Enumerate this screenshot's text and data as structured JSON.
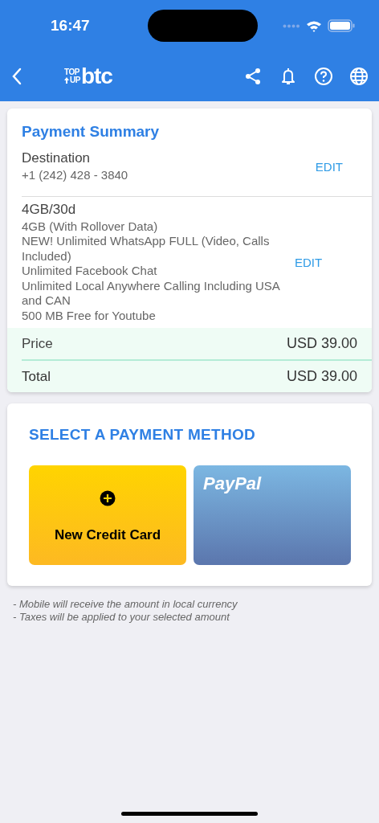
{
  "status_bar": {
    "time": "16:47"
  },
  "nav": {
    "logo": {
      "top": "TOP",
      "up": "UP",
      "brand": "btc"
    }
  },
  "summary": {
    "title": "Payment Summary",
    "destination": {
      "label": "Destination",
      "value": "+1 (242) 428 - 3840",
      "action": "EDIT"
    },
    "plan": {
      "name": "4GB/30d",
      "lines": [
        "4GB (With Rollover Data)",
        "NEW! Unlimited WhatsApp FULL (Video, Calls Included)",
        "Unlimited Facebook Chat",
        "Unlimited Local Anywhere Calling Including USA and CAN",
        "500 MB Free for Youtube"
      ],
      "action": "EDIT"
    },
    "totals": [
      {
        "label": "Price",
        "value": "USD 39.00",
        "kind": "price"
      },
      {
        "label": "Total",
        "value": "USD 39.00",
        "kind": "total"
      }
    ]
  },
  "payment": {
    "title": "SELECT A PAYMENT METHOD",
    "methods": [
      {
        "kind": "card",
        "label": "New Credit Card"
      },
      {
        "kind": "paypal",
        "label": "PayPal"
      }
    ]
  },
  "notes": [
    "- Mobile will receive the amount in local currency",
    "- Taxes will be applied to your selected amount"
  ]
}
